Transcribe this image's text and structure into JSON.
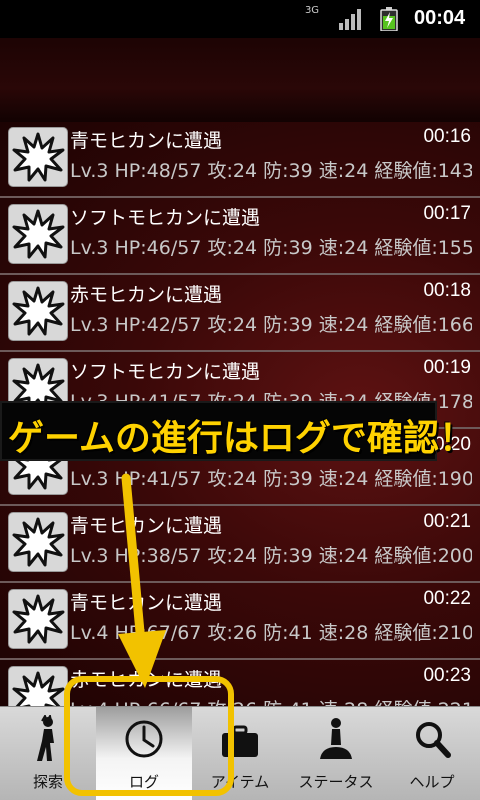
{
  "status_bar": {
    "network": "3G",
    "clock": "00:04"
  },
  "log_entries": [
    {
      "title": "青モヒカンに遭遇",
      "time": "00:16",
      "stats": "Lv.3 HP:48/57 攻:24 防:39 速:24 経験値:143"
    },
    {
      "title": "ソフトモヒカンに遭遇",
      "time": "00:17",
      "stats": "Lv.3 HP:46/57 攻:24 防:39 速:24 経験値:155"
    },
    {
      "title": "赤モヒカンに遭遇",
      "time": "00:18",
      "stats": "Lv.3 HP:42/57 攻:24 防:39 速:24 経験値:166"
    },
    {
      "title": "ソフトモヒカンに遭遇",
      "time": "00:19",
      "stats": "Lv.3 HP:41/57 攻:24 防:39 速:24 経験値:178"
    },
    {
      "title": "",
      "time": "00:20",
      "stats": "Lv.3 HP:41/57 攻:24 防:39 速:24 経験値:190"
    },
    {
      "title": "青モヒカンに遭遇",
      "time": "00:21",
      "stats": "Lv.3 HP:38/57 攻:24 防:39 速:24 経験値:200"
    },
    {
      "title": "青モヒカンに遭遇",
      "time": "00:22",
      "stats": "Lv.4 HP:67/67 攻:26 防:41 速:28 経験値:210"
    },
    {
      "title": "赤モヒカンに遭遇",
      "time": "00:23",
      "stats": "Lv.4 HP:66/67 攻:26 防:41 速:28 経験値:221"
    }
  ],
  "banner": {
    "text": "ゲームの進行はログで確認！",
    "color": "#ffd200"
  },
  "tabs": [
    {
      "label": "探索",
      "icon": "walker-icon"
    },
    {
      "label": "ログ",
      "icon": "clock-icon",
      "active": true
    },
    {
      "label": "アイテム",
      "icon": "bag-icon"
    },
    {
      "label": "ステータス",
      "icon": "person-icon"
    },
    {
      "label": "ヘルプ",
      "icon": "search-icon"
    }
  ],
  "colors": {
    "accent": "#f2c200",
    "list_background": "#3a0808"
  }
}
